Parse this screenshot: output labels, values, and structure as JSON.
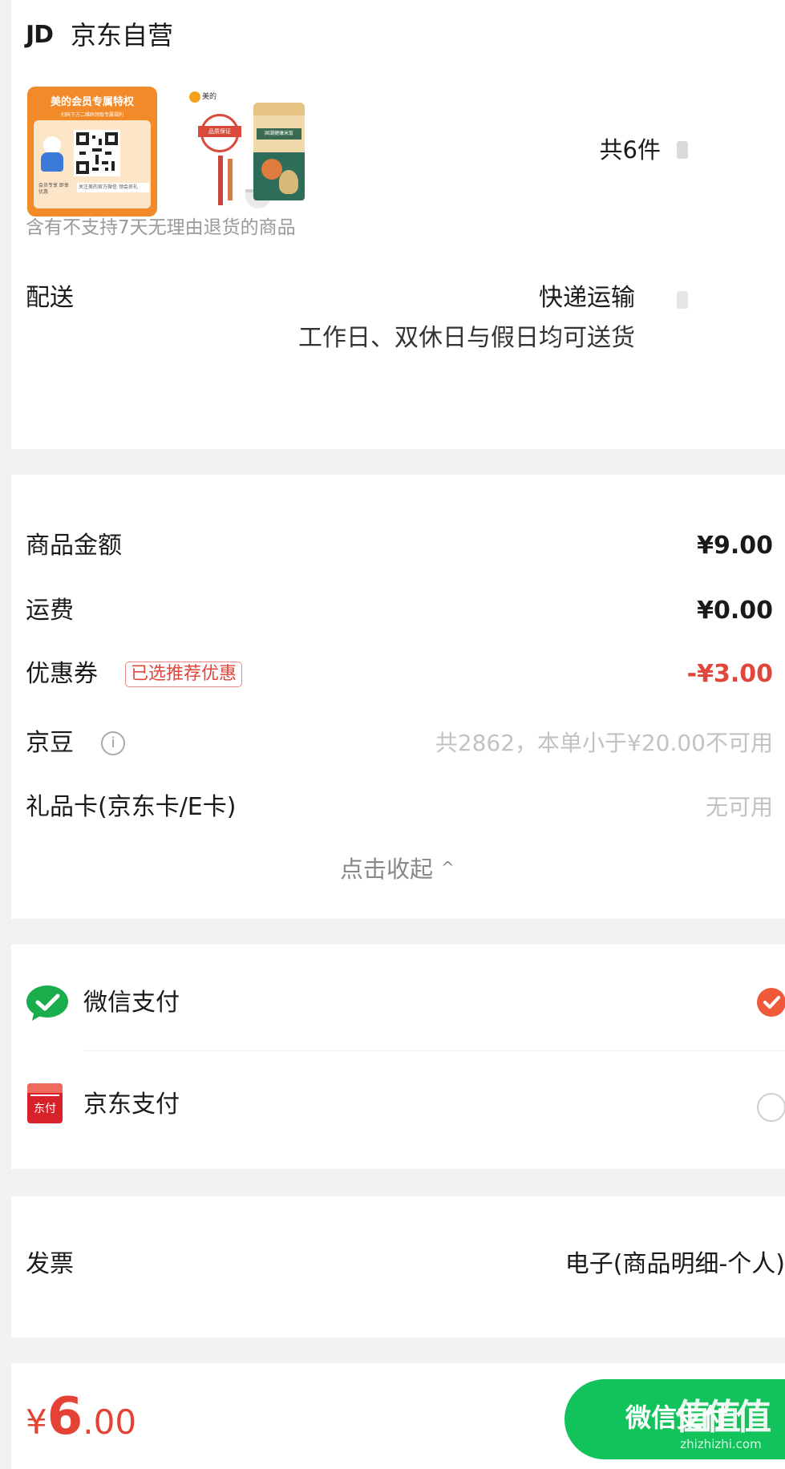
{
  "store": {
    "logo": "JD",
    "name": "京东自营",
    "product_count": "共6件",
    "return_notice": "含有不支持7天无理由退货的商品",
    "thumb1": {
      "banner": "美的会员专属特权",
      "subline": "扫码下方二维码领取专属福利",
      "note_left": "会员专享 即享优惠",
      "note_right": "关注美的官方微信 领会员礼"
    },
    "thumb2": {
      "badge": "美的",
      "seal": "品质保证",
      "bag_label": "国潮健康米饭"
    }
  },
  "delivery": {
    "label": "配送",
    "method": "快递运输",
    "schedule": "工作日、双休日与假日均可送货"
  },
  "price": {
    "goods_label": "商品金额",
    "goods_value": "¥9.00",
    "shipping_label": "运费",
    "shipping_value": "¥0.00",
    "coupon_label": "优惠券",
    "coupon_tag": "已选推荐优惠",
    "coupon_value": "-¥3.00",
    "jingdou_label": "京豆",
    "jingdou_info_icon": "i",
    "jingdou_value": "共2862，本单小于¥20.00不可用",
    "giftcard_label": "礼品卡(京东卡/E卡)",
    "giftcard_value": "无可用",
    "collapse_label": "点击收起",
    "collapse_icon": "^"
  },
  "payment": {
    "wechat_label": "微信支付",
    "wechat_selected": true,
    "jdpay_label": "京东支付",
    "jdpay_icon_text": "东付",
    "jdpay_selected": false
  },
  "invoice": {
    "label": "发票",
    "value": "电子(商品明细-个人)"
  },
  "footer": {
    "currency": "¥",
    "amount_int": "6",
    "amount_dec": ".00",
    "pay_button": "微信支付",
    "watermark": "值值值",
    "watermark_url": "zhizhizhi.com"
  },
  "colors": {
    "accent_red": "#e0463b",
    "wechat_green": "#1aad4b",
    "pay_button_green": "#12c25a",
    "jdpay_red": "#d8222a"
  }
}
